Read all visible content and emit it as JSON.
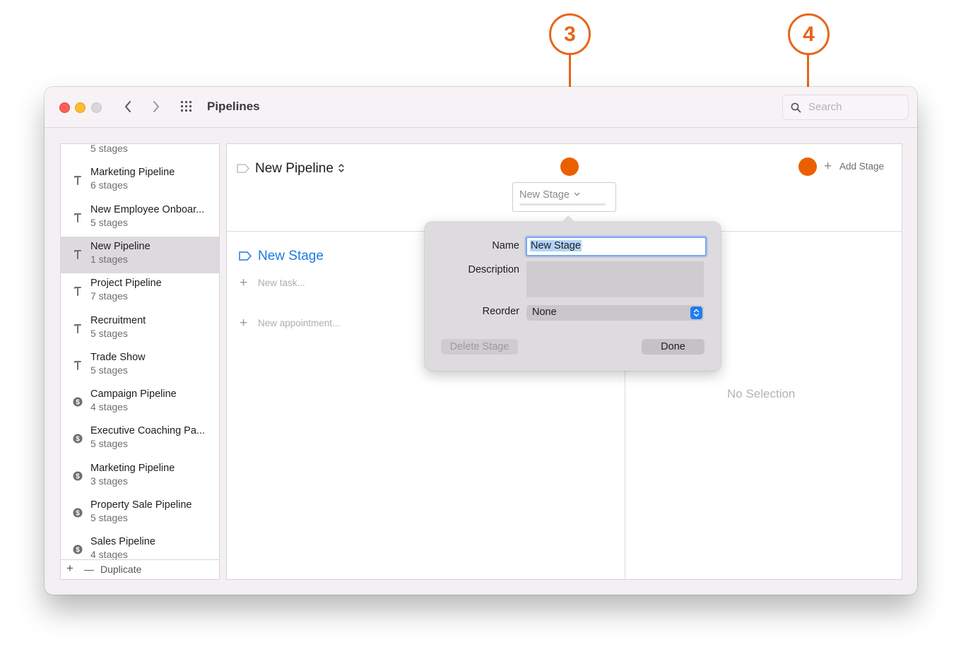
{
  "window": {
    "title": "Pipelines",
    "search_placeholder": "Search"
  },
  "sidebar": {
    "items": [
      {
        "name": "",
        "sub": "5 stages",
        "icon": "hammer-icon",
        "partial": true
      },
      {
        "name": "Marketing Pipeline",
        "sub": "6 stages",
        "icon": "hammer-icon"
      },
      {
        "name": "New Employee Onboar...",
        "sub": "5 stages",
        "icon": "hammer-icon"
      },
      {
        "name": "New Pipeline",
        "sub": "1 stages",
        "icon": "hammer-icon",
        "selected": true
      },
      {
        "name": "Project Pipeline",
        "sub": "7 stages",
        "icon": "hammer-icon"
      },
      {
        "name": "Recruitment",
        "sub": "5 stages",
        "icon": "hammer-icon"
      },
      {
        "name": "Trade Show",
        "sub": "5 stages",
        "icon": "hammer-icon"
      },
      {
        "name": "Campaign Pipeline",
        "sub": "4 stages",
        "icon": "dollar-icon"
      },
      {
        "name": "Executive Coaching Pa...",
        "sub": "5 stages",
        "icon": "dollar-icon"
      },
      {
        "name": "Marketing Pipeline",
        "sub": "3 stages",
        "icon": "dollar-icon"
      },
      {
        "name": "Property Sale Pipeline",
        "sub": "5 stages",
        "icon": "dollar-icon"
      },
      {
        "name": "Sales Pipeline",
        "sub": "4 stages",
        "icon": "dollar-icon"
      }
    ],
    "footer": {
      "add": "+",
      "remove": "—",
      "duplicate": "Duplicate"
    }
  },
  "main": {
    "pipeline_title": "New Pipeline",
    "add_stage": "Add Stage",
    "stage_tab": "New Stage",
    "stage_name": "New Stage",
    "new_task": "New task...",
    "new_appointment": "New appointment...",
    "no_selection": "No Selection"
  },
  "popover": {
    "name_label": "Name",
    "name_value": "New Stage",
    "description_label": "Description",
    "reorder_label": "Reorder",
    "reorder_value": "None",
    "delete_button": "Delete Stage",
    "done_button": "Done"
  },
  "callouts": {
    "three": "3",
    "four": "4"
  },
  "colors": {
    "accent": "#1f7ae0",
    "callout": "#e8651a"
  }
}
